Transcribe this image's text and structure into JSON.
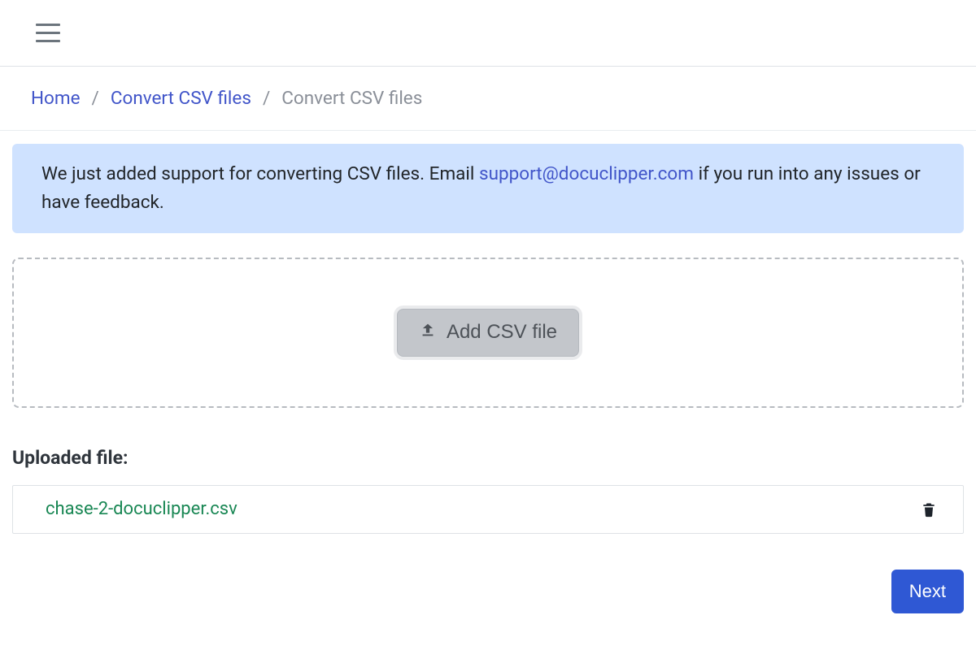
{
  "breadcrumb": {
    "items": [
      {
        "label": "Home",
        "active": false
      },
      {
        "label": "Convert CSV files",
        "active": false
      },
      {
        "label": "Convert CSV files",
        "active": true
      }
    ],
    "separator": "/"
  },
  "alert": {
    "text_before": "We just added support for converting CSV files. Email ",
    "email": "support@docuclipper.com",
    "text_after": " if you run into any issues or have feedback."
  },
  "dropzone": {
    "button_label": "Add CSV file"
  },
  "uploaded": {
    "heading": "Uploaded file:",
    "files": [
      {
        "name": "chase-2-docuclipper.csv"
      }
    ]
  },
  "actions": {
    "next_label": "Next"
  }
}
